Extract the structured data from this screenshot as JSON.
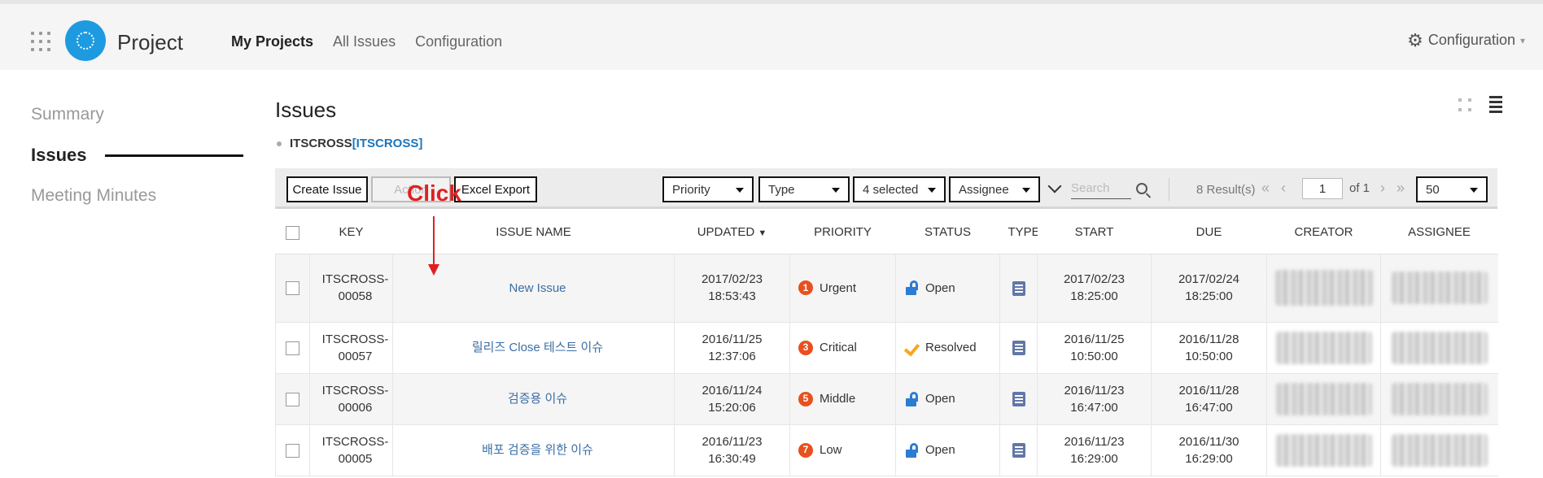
{
  "header": {
    "app_title": "Project",
    "nav": [
      "My Projects",
      "All Issues",
      "Configuration"
    ],
    "config_label": "Configuration"
  },
  "sidebar": {
    "items": [
      "Summary",
      "Issues",
      "Meeting Minutes"
    ],
    "active": "Issues"
  },
  "main": {
    "title": "Issues",
    "breadcrumb": {
      "project": "ITSCROSS",
      "code": "[ITSCROSS]"
    }
  },
  "toolbar": {
    "create_label": "Create Issue",
    "action_label": "Action",
    "export_label": "Excel Export",
    "filters": {
      "priority": "Priority",
      "type": "Type",
      "status": "4 selected",
      "assignee": "Assignee"
    },
    "search_placeholder": "Search",
    "results": "8 Result(s)",
    "page": "1",
    "of_pages": "of 1",
    "page_size": "50"
  },
  "table": {
    "columns": {
      "key": "KEY",
      "name": "ISSUE NAME",
      "updated": "UPDATED",
      "priority": "PRIORITY",
      "status": "STATUS",
      "type": "TYPE",
      "start": "START",
      "due": "DUE",
      "creator": "CREATOR",
      "assignee": "ASSIGNEE"
    },
    "rows": [
      {
        "key1": "ITSCROSS-",
        "key2": "00058",
        "name": "New Issue",
        "updated1": "2017/02/23",
        "updated2": "18:53:43",
        "prio_num": "1",
        "priority": "Urgent",
        "status": "Open",
        "status_icon": "unlock-icon",
        "start1": "2017/02/23",
        "start2": "18:25:00",
        "due1": "2017/02/24",
        "due2": "18:25:00"
      },
      {
        "key1": "ITSCROSS-",
        "key2": "00057",
        "name": "릴리즈 Close 테스트 이슈",
        "updated1": "2016/11/25",
        "updated2": "12:37:06",
        "prio_num": "3",
        "priority": "Critical",
        "status": "Resolved",
        "status_icon": "check-icon",
        "start1": "2016/11/25",
        "start2": "10:50:00",
        "due1": "2016/11/28",
        "due2": "10:50:00"
      },
      {
        "key1": "ITSCROSS-",
        "key2": "00006",
        "name": "검증용 이슈",
        "updated1": "2016/11/24",
        "updated2": "15:20:06",
        "prio_num": "5",
        "priority": "Middle",
        "status": "Open",
        "status_icon": "unlock-icon",
        "start1": "2016/11/23",
        "start2": "16:47:00",
        "due1": "2016/11/28",
        "due2": "16:47:00"
      },
      {
        "key1": "ITSCROSS-",
        "key2": "00005",
        "name": "배포 검증을 위한 이슈",
        "updated1": "2016/11/23",
        "updated2": "16:30:49",
        "prio_num": "7",
        "priority": "Low",
        "status": "Open",
        "status_icon": "unlock-icon",
        "start1": "2016/11/23",
        "start2": "16:29:00",
        "due1": "2016/11/30",
        "due2": "16:29:00"
      }
    ]
  },
  "annotation": {
    "text": "Click"
  },
  "colors": {
    "accent": "#1e9be0",
    "link": "#3a6ea5",
    "priority_badge": "#e8501e",
    "annotation": "#e02020"
  }
}
